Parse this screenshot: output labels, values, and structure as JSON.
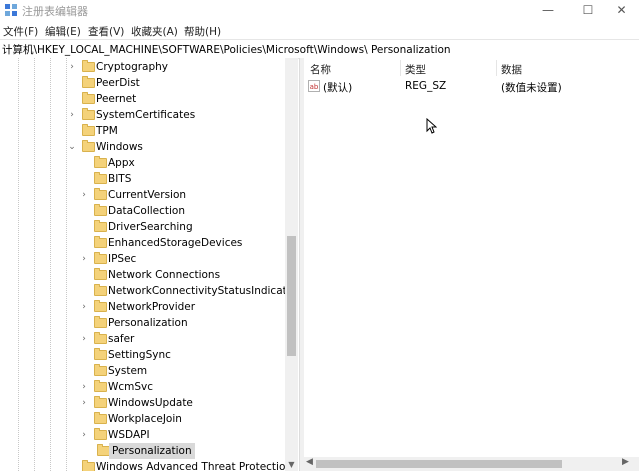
{
  "window": {
    "title": "注册表编辑器",
    "minimize_glyph": "—",
    "maximize_glyph": "☐",
    "close_glyph": "✕"
  },
  "menu": [
    "文件(F)",
    "编辑(E)",
    "查看(V)",
    "收藏夹(A)",
    "帮助(H)"
  ],
  "address": "计算机\\HKEY_LOCAL_MACHINE\\SOFTWARE\\Policies\\Microsoft\\Windows\\ Personalization",
  "tree": {
    "items": [
      {
        "label": "Cryptography",
        "level": 0,
        "arrow": "›"
      },
      {
        "label": "PeerDist",
        "level": 0,
        "arrow": ""
      },
      {
        "label": "Peernet",
        "level": 0,
        "arrow": ""
      },
      {
        "label": "SystemCertificates",
        "level": 0,
        "arrow": "›"
      },
      {
        "label": "TPM",
        "level": 0,
        "arrow": ""
      },
      {
        "label": "Windows",
        "level": 0,
        "arrow": "⌄"
      },
      {
        "label": "Appx",
        "level": 1,
        "arrow": ""
      },
      {
        "label": "BITS",
        "level": 1,
        "arrow": ""
      },
      {
        "label": "CurrentVersion",
        "level": 1,
        "arrow": "›"
      },
      {
        "label": "DataCollection",
        "level": 1,
        "arrow": ""
      },
      {
        "label": "DriverSearching",
        "level": 1,
        "arrow": ""
      },
      {
        "label": "EnhancedStorageDevices",
        "level": 1,
        "arrow": ""
      },
      {
        "label": "IPSec",
        "level": 1,
        "arrow": "›"
      },
      {
        "label": "Network Connections",
        "level": 1,
        "arrow": ""
      },
      {
        "label": "NetworkConnectivityStatusIndicator",
        "level": 1,
        "arrow": ""
      },
      {
        "label": "NetworkProvider",
        "level": 1,
        "arrow": "›"
      },
      {
        "label": "Personalization",
        "level": 1,
        "arrow": ""
      },
      {
        "label": "safer",
        "level": 1,
        "arrow": "›"
      },
      {
        "label": "SettingSync",
        "level": 1,
        "arrow": ""
      },
      {
        "label": "System",
        "level": 1,
        "arrow": ""
      },
      {
        "label": "WcmSvc",
        "level": 1,
        "arrow": "›"
      },
      {
        "label": "WindowsUpdate",
        "level": 1,
        "arrow": "›"
      },
      {
        "label": "WorkplaceJoin",
        "level": 1,
        "arrow": ""
      },
      {
        "label": "WSDAPI",
        "level": 1,
        "arrow": "›"
      },
      {
        "label": "Personalization",
        "level": 1,
        "arrow": "",
        "selected": true
      },
      {
        "label": "Windows Advanced Threat Protection",
        "level": 0,
        "arrow": ""
      }
    ]
  },
  "list": {
    "columns": [
      "名称",
      "类型",
      "数据"
    ],
    "rows": [
      {
        "icon": "ab",
        "name": "(默认)",
        "type": "REG_SZ",
        "data": "(数值未设置)"
      }
    ]
  },
  "scroll": {
    "up": "▲",
    "down": "▼",
    "left": "◀",
    "right": "▶"
  }
}
